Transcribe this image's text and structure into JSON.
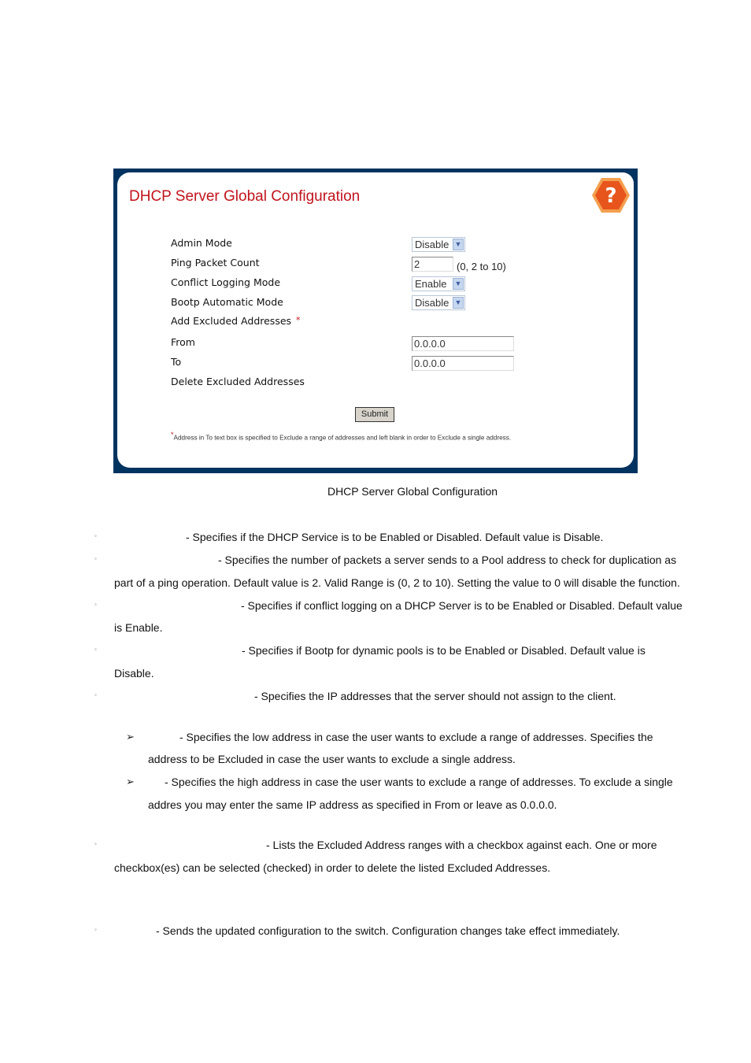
{
  "panel": {
    "title": "DHCP Server Global Configuration",
    "help_icon": "question-mark-hexagon",
    "colors": {
      "frame": "#00335f",
      "title": "#c0141c",
      "help": "#e8551c"
    },
    "fields": {
      "admin_mode": {
        "label": "Admin Mode",
        "value": "Disable"
      },
      "ping_packet_count": {
        "label": "Ping Packet Count",
        "value": "2",
        "hint": "(0, 2 to 10)"
      },
      "conflict_logging_mode": {
        "label": "Conflict Logging Mode",
        "value": "Enable"
      },
      "bootp_automatic_mode": {
        "label": "Bootp Automatic Mode",
        "value": "Disable"
      },
      "add_excluded": {
        "label": "Add Excluded Addresses",
        "asterisk": "*"
      },
      "from": {
        "label": "From",
        "value": "0.0.0.0"
      },
      "to": {
        "label": "To",
        "value": "0.0.0.0"
      },
      "delete_excluded": {
        "label": "Delete Excluded Addresses"
      }
    },
    "submit_label": "Submit",
    "note_star": "*",
    "note": "Address in To text box is specified to Exclude a range of addresses and left blank in order to Exclude a single address."
  },
  "caption": "DHCP Server Global Configuration",
  "descriptions": [
    {
      "line1": "- Specifies if the DHCP Service is to be Enabled or Disabled. Default value is Disable.",
      "line2": ""
    },
    {
      "line1": "- Specifies the number of packets a server sends to a Pool address to check for duplication as",
      "line2": "part of a ping operation. Default value is 2. Valid Range is (0, 2 to 10). Setting the value to 0 will disable the function."
    },
    {
      "line1": "- Specifies if conflict logging on a DHCP Server is to be Enabled or Disabled. Default value",
      "line2": "is Enable."
    },
    {
      "line1": "- Specifies if Bootp for dynamic pools is to be Enabled or Disabled. Default value is",
      "line2": "Disable."
    },
    {
      "line1": "- Specifies the IP addresses that the server should not assign to the client.",
      "line2": ""
    },
    {
      "line1": "- Lists the Excluded Address ranges with a checkbox against each. One or more",
      "line2": "checkbox(es) can be selected (checked) in order to delete the listed Excluded Addresses."
    },
    {
      "line1": "- Sends the updated configuration to the switch. Configuration changes take effect immediately.",
      "line2": ""
    }
  ],
  "sub_descriptions": [
    {
      "line1": "- Specifies the low address in case the user wants to exclude a range of addresses. Specifies the",
      "line2": "address to be Excluded in case the user wants to exclude a single address."
    },
    {
      "line1": "- Specifies the high address in case the user wants to exclude a range of addresses. To exclude a single",
      "line2": "addres you may enter the same IP address as specified in From or leave as 0.0.0.0."
    }
  ],
  "bullet_glyph": "◦",
  "arrow_glyph": "➢"
}
